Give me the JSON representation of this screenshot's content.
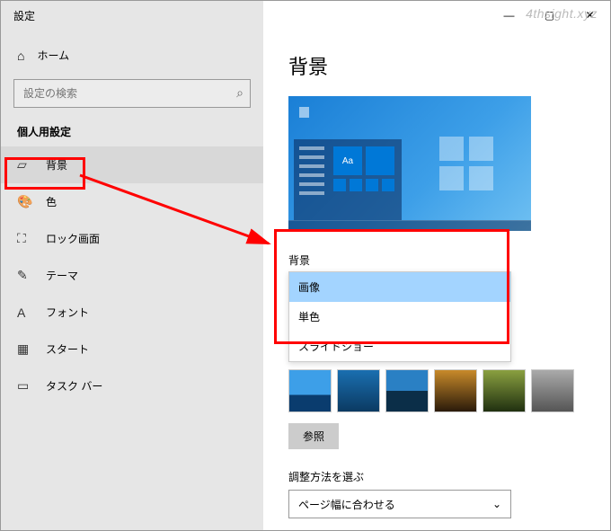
{
  "window": {
    "title": "設定"
  },
  "watermark": "4thsight.xyz",
  "sidebar": {
    "home": "ホーム",
    "search_placeholder": "設定の検索",
    "section_label": "個人用設定",
    "items": [
      {
        "icon": "image-icon",
        "label": "背景",
        "active": true
      },
      {
        "icon": "palette-icon",
        "label": "色"
      },
      {
        "icon": "lock-icon",
        "label": "ロック画面"
      },
      {
        "icon": "themes-icon",
        "label": "テーマ"
      },
      {
        "icon": "font-icon",
        "label": "フォント"
      },
      {
        "icon": "start-icon",
        "label": "スタート"
      },
      {
        "icon": "taskbar-icon",
        "label": "タスク バー"
      }
    ]
  },
  "main": {
    "page_title": "背景",
    "preview_aa": "Aa",
    "bg_label": "背景",
    "dropdown_options": [
      {
        "label": "画像",
        "selected": true
      },
      {
        "label": "単色"
      },
      {
        "label": "スライドショー"
      }
    ],
    "browse_label": "参照",
    "fit_label": "調整方法を選ぶ",
    "fit_value": "ページ幅に合わせる"
  }
}
